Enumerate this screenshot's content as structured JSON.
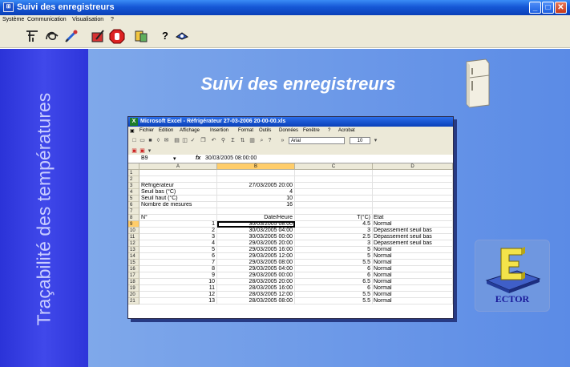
{
  "window": {
    "title": "Suivi des enregistreurs",
    "icon": "app-icon"
  },
  "menu": [
    "Système",
    "Communication",
    "Visualisation",
    "?"
  ],
  "toolbar": [
    "connect-icon",
    "recorder-icon",
    "probe-icon",
    "edit-icon",
    "stop-icon",
    "settings-icon",
    "help-icon",
    "about-icon"
  ],
  "left_label": "Traçabilité des températures",
  "main_title": "Suivi des enregistreurs",
  "logo": {
    "text": "ECTOR"
  },
  "excel": {
    "title": "Microsoft Excel - Réfrigérateur 27-03-2006 20-00-00.xls",
    "menu": [
      "Fichier",
      "Edition",
      "Affichage",
      "Insertion",
      "Format",
      "Outils",
      "Données",
      "Fenêtre",
      "?",
      "Acrobat"
    ],
    "font": "Arial",
    "font_size": "10",
    "name_box": "B9",
    "formula": "30/03/2005 08:00:00",
    "columns": [
      "A",
      "B",
      "C",
      "D"
    ],
    "rows": [
      {
        "n": "1",
        "a": "",
        "b": "",
        "c": "",
        "d": ""
      },
      {
        "n": "2",
        "a": "",
        "b": "",
        "c": "",
        "d": ""
      },
      {
        "n": "3",
        "a": "Réfrigérateur",
        "b": "27/03/2005 20:00",
        "c": "",
        "d": ""
      },
      {
        "n": "4",
        "a": "Seuil bas (°C)",
        "b": "4",
        "c": "",
        "d": ""
      },
      {
        "n": "5",
        "a": "Seuil haut (°C)",
        "b": "10",
        "c": "",
        "d": ""
      },
      {
        "n": "6",
        "a": "Nombre de mesures",
        "b": "16",
        "c": "",
        "d": ""
      },
      {
        "n": "7",
        "a": "",
        "b": "",
        "c": "",
        "d": ""
      },
      {
        "n": "8",
        "a": "N°",
        "b": "Date/Heure",
        "c": "T(°C)",
        "d": "Etat"
      },
      {
        "n": "9",
        "a": "1",
        "b": "30/03/2005 08:00",
        "c": "4.5",
        "d": "Normal"
      },
      {
        "n": "10",
        "a": "2",
        "b": "30/03/2005 04:00",
        "c": "3",
        "d": "Dépassement seuil bas"
      },
      {
        "n": "11",
        "a": "3",
        "b": "30/03/2005 00:00",
        "c": "2.5",
        "d": "Dépassement seuil bas"
      },
      {
        "n": "12",
        "a": "4",
        "b": "29/03/2005 20:00",
        "c": "3",
        "d": "Dépassement seuil bas"
      },
      {
        "n": "13",
        "a": "5",
        "b": "29/03/2005 16:00",
        "c": "5",
        "d": "Normal"
      },
      {
        "n": "14",
        "a": "6",
        "b": "29/03/2005 12:00",
        "c": "5",
        "d": "Normal"
      },
      {
        "n": "15",
        "a": "7",
        "b": "29/03/2005 08:00",
        "c": "5.5",
        "d": "Normal"
      },
      {
        "n": "16",
        "a": "8",
        "b": "29/03/2005 04:00",
        "c": "6",
        "d": "Normal"
      },
      {
        "n": "17",
        "a": "9",
        "b": "29/03/2005 00:00",
        "c": "6",
        "d": "Normal"
      },
      {
        "n": "18",
        "a": "10",
        "b": "28/03/2005 20:00",
        "c": "6.5",
        "d": "Normal"
      },
      {
        "n": "19",
        "a": "11",
        "b": "28/03/2005 16:00",
        "c": "6",
        "d": "Normal"
      },
      {
        "n": "20",
        "a": "12",
        "b": "28/03/2005 12:00",
        "c": "5.5",
        "d": "Normal"
      },
      {
        "n": "21",
        "a": "13",
        "b": "28/03/2005 08:00",
        "c": "5.5",
        "d": "Normal"
      }
    ]
  }
}
